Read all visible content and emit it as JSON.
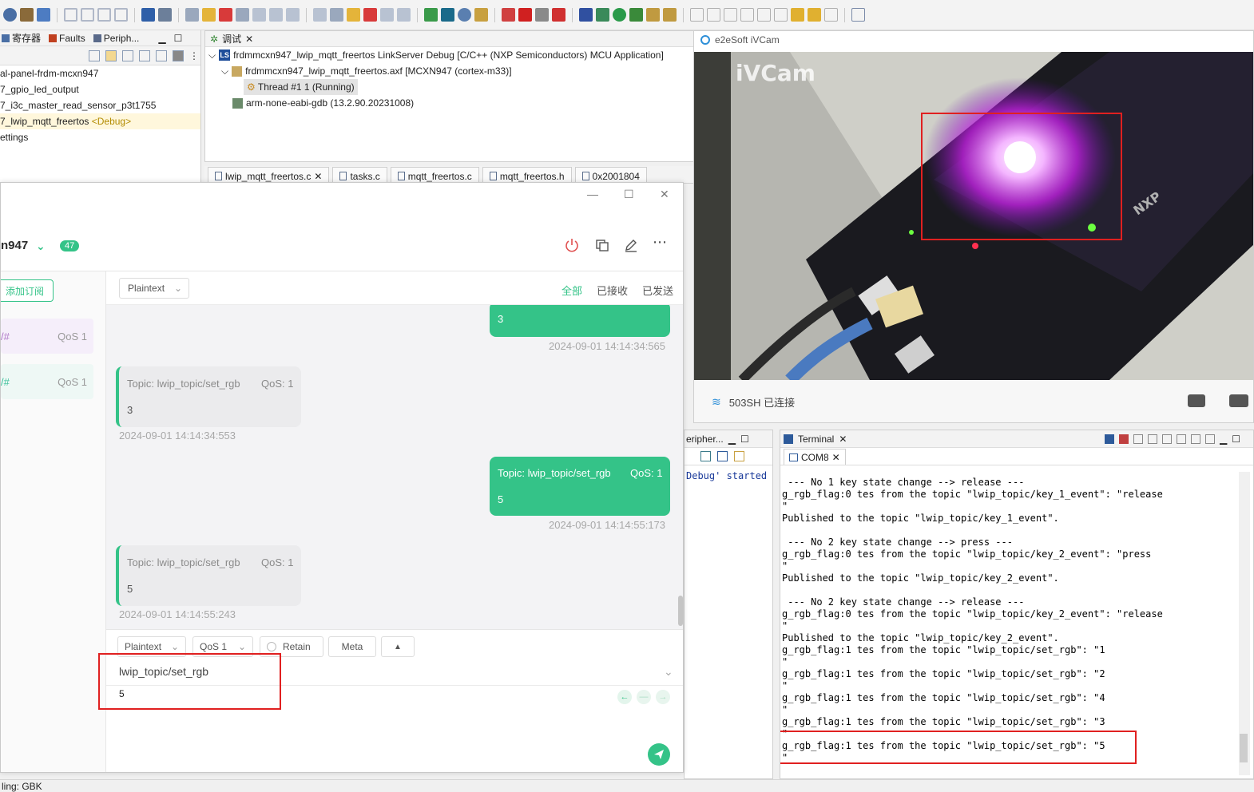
{
  "left_panel": {
    "tabs": [
      "寄存器",
      "Faults",
      "Periph..."
    ],
    "tree": [
      {
        "text": "al-panel-frdm-mcxn947"
      },
      {
        "text": "7_gpio_led_output"
      },
      {
        "text": "7_i3c_master_read_sensor_p3t1755"
      },
      {
        "text": "7_lwip_mqtt_freertos",
        "tag": "<Debug>"
      },
      {
        "text": "ettings"
      }
    ]
  },
  "debug_view": {
    "tab": "调试",
    "launch": "frdmmcxn947_lwip_mqtt_freertos LinkServer Debug [C/C++ (NXP Semiconductors) MCU Application]",
    "axf": "frdmmcxn947_lwip_mqtt_freertos.axf [MCXN947 (cortex-m33)]",
    "thread": "Thread #1 1 (Running)",
    "gdb": "arm-none-eabi-gdb (13.2.90.20231008)"
  },
  "editor_tabs": [
    "lwip_mqtt_freertos.c",
    "tasks.c",
    "mqtt_freertos.c",
    "mqtt_freertos.h",
    "0x2001804"
  ],
  "mqttx": {
    "connection_name": "n947",
    "badge": "47",
    "add_subscription": "添加订阅",
    "subscriptions": [
      {
        "topic": "/#",
        "qos": "QoS 1",
        "color": "#f5eefa"
      },
      {
        "topic": "/#",
        "qos": "QoS 1",
        "color": "#eef8f5"
      }
    ],
    "format": "Plaintext",
    "filters": {
      "all": "全部",
      "received": "已接收",
      "sent": "已发送"
    },
    "messages": [
      {
        "dir": "out",
        "topic": "",
        "qos": "",
        "payload": "3",
        "time": "2024-09-01 14:14:34:565"
      },
      {
        "dir": "in",
        "topic": "Topic: lwip_topic/set_rgb",
        "qos": "QoS: 1",
        "payload": "3",
        "time": "2024-09-01 14:14:34:553"
      },
      {
        "dir": "out",
        "topic": "Topic: lwip_topic/set_rgb",
        "qos": "QoS: 1",
        "payload": "5",
        "time": "2024-09-01 14:14:55:173"
      },
      {
        "dir": "in",
        "topic": "Topic: lwip_topic/set_rgb",
        "qos": "QoS: 1",
        "payload": "5",
        "time": "2024-09-01 14:14:55:243"
      }
    ],
    "composer": {
      "format": "Plaintext",
      "qos": "QoS 1",
      "retain": "Retain",
      "meta": "Meta",
      "topic": "lwip_topic/set_rgb",
      "payload": "5"
    }
  },
  "ivcam": {
    "title": "e2eSoft iVCam",
    "watermark": "iVCam",
    "board_label": "NXP",
    "wifi_status": "503SH 已连接"
  },
  "periph_pane": {
    "tab": "eripher...",
    "console_text": "Debug' started"
  },
  "terminal": {
    "tab": "Terminal",
    "session": "COM8",
    "lines": [
      " --- No 1 key state change --> release ---",
      "g_rgb_flag:0 tes from the topic \"lwip_topic/key_1_event\": \"release",
      "\"",
      "Published to the topic \"lwip_topic/key_1_event\".",
      "",
      " --- No 2 key state change --> press ---",
      "g_rgb_flag:0 tes from the topic \"lwip_topic/key_2_event\": \"press",
      "\"",
      "Published to the topic \"lwip_topic/key_2_event\".",
      "",
      " --- No 2 key state change --> release ---",
      "g_rgb_flag:0 tes from the topic \"lwip_topic/key_2_event\": \"release",
      "\"",
      "Published to the topic \"lwip_topic/key_2_event\".",
      "g_rgb_flag:1 tes from the topic \"lwip_topic/set_rgb\": \"1",
      "\"",
      "g_rgb_flag:1 tes from the topic \"lwip_topic/set_rgb\": \"2",
      "\"",
      "g_rgb_flag:1 tes from the topic \"lwip_topic/set_rgb\": \"4",
      "\"",
      "g_rgb_flag:1 tes from the topic \"lwip_topic/set_rgb\": \"3",
      "\"",
      "g_rgb_flag:1 tes from the topic \"lwip_topic/set_rgb\": \"5",
      "\""
    ]
  },
  "statusbar": {
    "text": "ling: GBK"
  },
  "colors": {
    "accent": "#34c388",
    "highlight": "#e02020"
  }
}
